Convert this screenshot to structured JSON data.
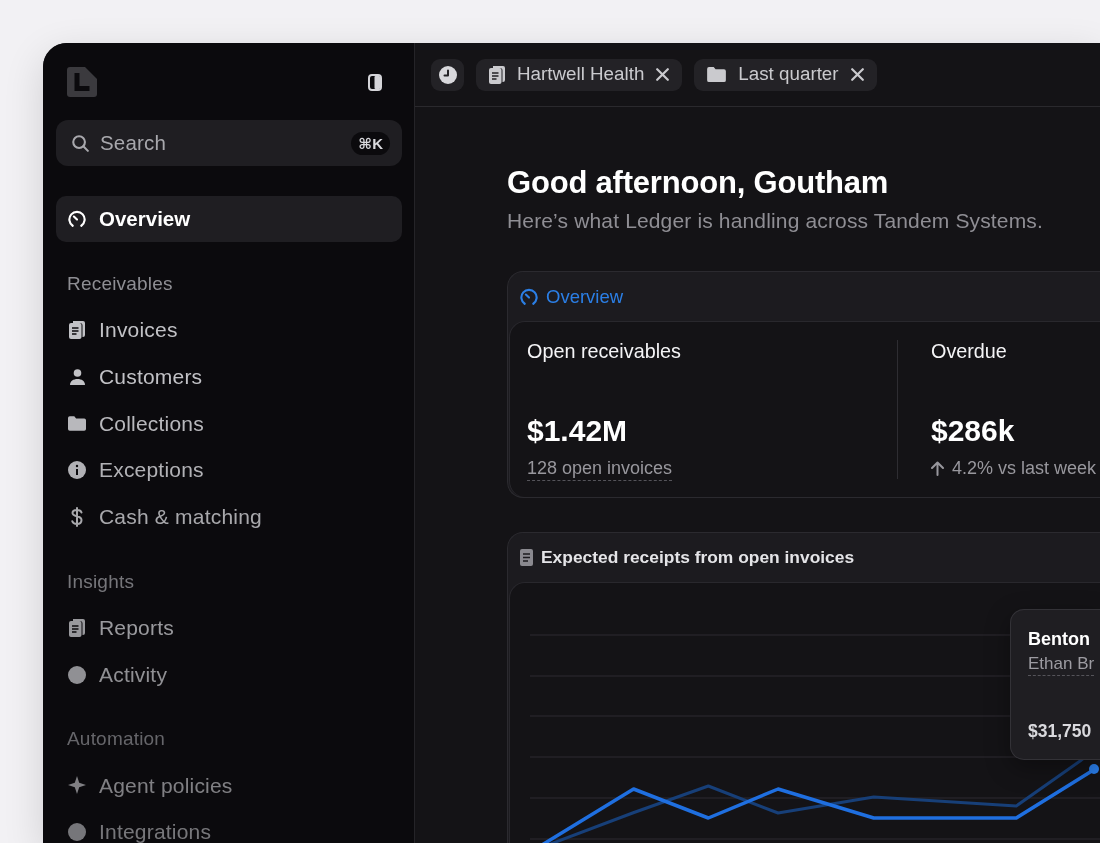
{
  "sidebar": {
    "search": {
      "placeholder": "Search",
      "shortcut": "⌘K"
    },
    "sections": [
      {
        "items": [
          {
            "label": "Overview",
            "selected": true
          }
        ]
      },
      {
        "title": "Receivables",
        "items": [
          {
            "label": "Invoices",
            "selected": false
          },
          {
            "label": "Customers",
            "selected": false
          },
          {
            "label": "Collections",
            "selected": false
          },
          {
            "label": "Exceptions",
            "selected": false
          },
          {
            "label": "Cash & matching",
            "selected": false
          }
        ]
      },
      {
        "title": "Insights",
        "items": [
          {
            "label": "Reports",
            "selected": false
          },
          {
            "label": "Activity",
            "selected": false
          }
        ]
      },
      {
        "title": "Automation",
        "items": [
          {
            "label": "Agent policies",
            "selected": false
          },
          {
            "label": "Integrations",
            "selected": false
          }
        ]
      }
    ]
  },
  "toolbar": {
    "filters": [
      {
        "label": "Hartwell Health"
      },
      {
        "label": "Last quarter"
      }
    ]
  },
  "greeting": {
    "title": "Good afternoon, Goutham",
    "subtitle": "Here’s what Ledger is handling across Tandem Systems."
  },
  "overview_card": {
    "title": "Overview",
    "metrics": [
      {
        "kind": "count",
        "label": "Open receivables",
        "value": "$1.42M",
        "note": "128 open invoices"
      },
      {
        "kind": "change",
        "label": "Overdue",
        "value": "$286k",
        "note": "4.2% vs last week",
        "rising": true
      }
    ]
  },
  "receipts_card": {
    "title": "Expected receipts from open invoices",
    "tooltip": {
      "title": "Benton",
      "subtitle": "Ethan Br",
      "amount": "$31,750"
    }
  }
}
